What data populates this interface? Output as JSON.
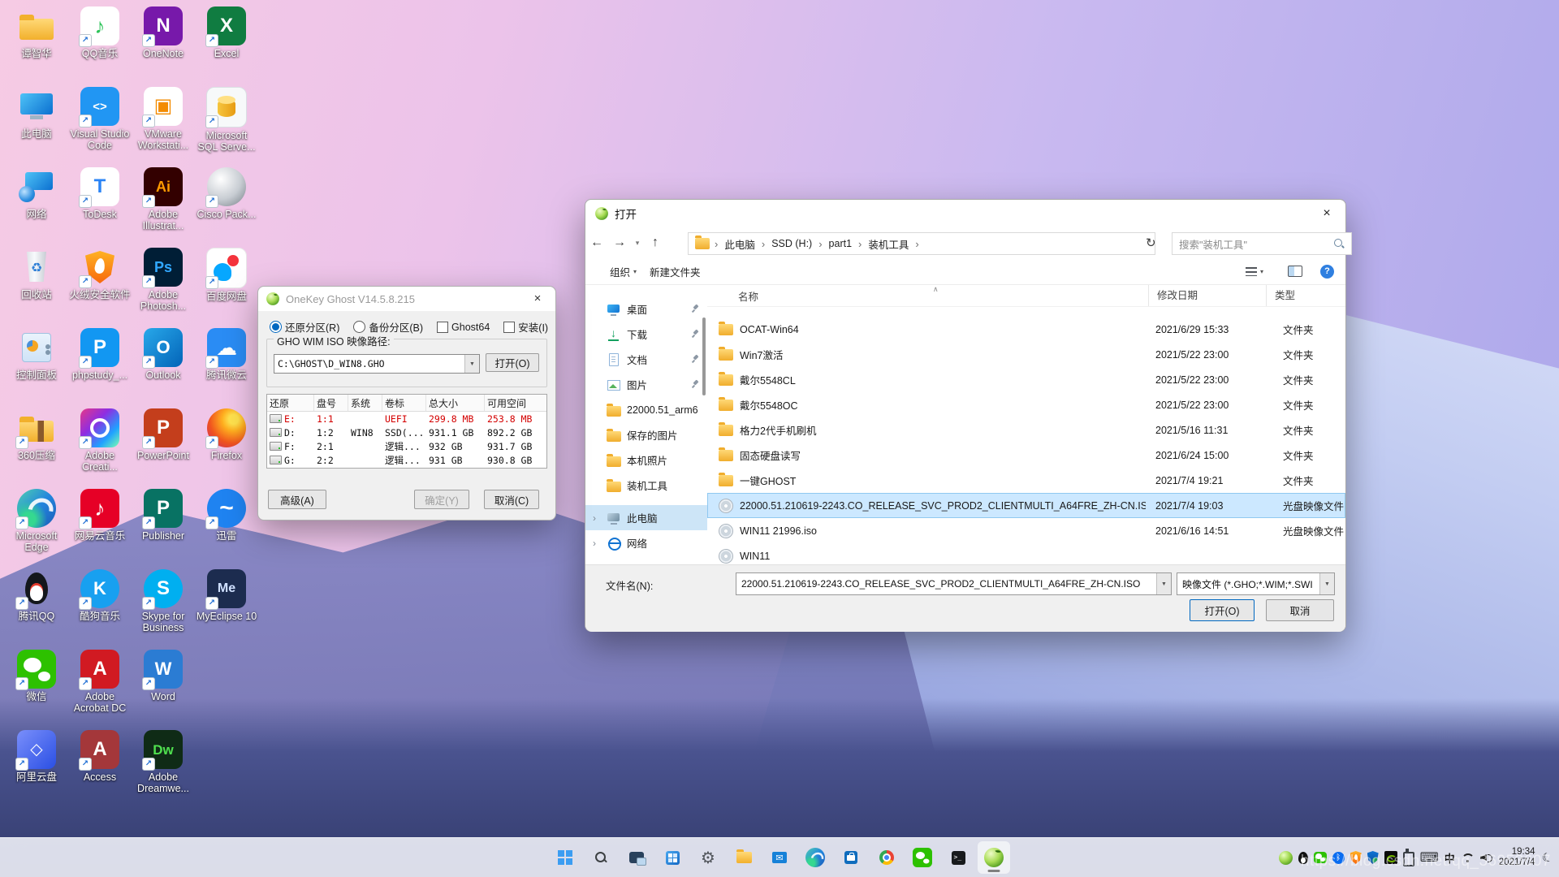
{
  "desktop": {
    "icons": [
      {
        "id": "user-folder",
        "label": "谭智华",
        "kind": "folder"
      },
      {
        "id": "this-pc",
        "label": "此电脑",
        "kind": "this-pc"
      },
      {
        "id": "network",
        "label": "网络",
        "kind": "network"
      },
      {
        "id": "recycle-bin",
        "label": "回收站",
        "kind": "recycle"
      },
      {
        "id": "control-panel",
        "label": "控制面板",
        "kind": "control-panel"
      },
      {
        "id": "360zip",
        "label": "360压缩",
        "kind": "folder-belt",
        "shortcut": true
      },
      {
        "id": "edge",
        "label": "Microsoft Edge",
        "kind": "edge",
        "shortcut": true
      },
      {
        "id": "tencent-qq",
        "label": "腾讯QQ",
        "kind": "qq",
        "shortcut": true
      },
      {
        "id": "wechat",
        "label": "微信",
        "kind": "wechat",
        "shortcut": true
      },
      {
        "id": "aliyun-drive",
        "label": "阿里云盘",
        "kind": "square",
        "bg": "linear-gradient(135deg,#7a8ffb,#2a4fe4)",
        "glyph": "◇",
        "fg": "#ffffff",
        "gs": 20,
        "shortcut": true
      },
      {
        "id": "qq-music",
        "label": "QQ音乐",
        "kind": "square",
        "bg": "#ffffff",
        "glyph": "♪",
        "fg": "#2ec45a",
        "gs": 26,
        "shortcut": true
      },
      {
        "id": "vscode",
        "label": "Visual Studio Code",
        "kind": "square",
        "bg": "#2196f3",
        "glyph": "<>",
        "fg": "#ffffff",
        "gs": 15,
        "shortcut": true
      },
      {
        "id": "todesk",
        "label": "ToDesk",
        "kind": "square",
        "bg": "#ffffff",
        "glyph": "T",
        "fg": "#2b84f5",
        "gs": 24,
        "shortcut": true
      },
      {
        "id": "huorong",
        "label": "火绒安全软件",
        "kind": "huorong",
        "shortcut": true
      },
      {
        "id": "phpstudy",
        "label": "phpstudy_...",
        "kind": "square",
        "bg": "#1297f2",
        "glyph": "P",
        "fg": "#ffffff",
        "gs": 24,
        "shortcut": true
      },
      {
        "id": "adobe-cc",
        "label": "Adobe Creati...",
        "kind": "adobe-cc",
        "shortcut": true
      },
      {
        "id": "netease-music",
        "label": "网易云音乐",
        "kind": "square",
        "bg": "#e60026",
        "glyph": "♪",
        "fg": "#ffffff",
        "gs": 26,
        "shortcut": true
      },
      {
        "id": "kugou-music",
        "label": "酷狗音乐",
        "kind": "circle",
        "bg": "#18a0f0",
        "glyph": "K",
        "fg": "#ffffff",
        "gs": 22,
        "shortcut": true
      },
      {
        "id": "acrobat",
        "label": "Adobe Acrobat DC",
        "kind": "square",
        "bg": "#d11a22",
        "glyph": "A",
        "fg": "#ffffff",
        "gs": 24,
        "shortcut": true
      },
      {
        "id": "access",
        "label": "Access",
        "kind": "square",
        "bg": "#a4373a",
        "glyph": "A",
        "fg": "#ffffff",
        "gs": 24,
        "shortcut": true
      },
      {
        "id": "onenote",
        "label": "OneNote",
        "kind": "square",
        "bg": "#7719aa",
        "glyph": "N",
        "fg": "#ffffff",
        "gs": 24,
        "shortcut": true
      },
      {
        "id": "vmware",
        "label": "VMware Workstati...",
        "kind": "square",
        "bg": "#ffffff",
        "glyph": "▣",
        "fg": "#f38b00",
        "gs": 24,
        "shortcut": true
      },
      {
        "id": "illustrator",
        "label": "Adobe Illustrat...",
        "kind": "square",
        "bg": "#330000",
        "glyph": "Ai",
        "fg": "#ff9a00",
        "gs": 18,
        "shortcut": true
      },
      {
        "id": "photoshop",
        "label": "Adobe Photosh...",
        "kind": "square",
        "bg": "#001e36",
        "glyph": "Ps",
        "fg": "#31a8ff",
        "gs": 18,
        "shortcut": true
      },
      {
        "id": "outlook",
        "label": "Outlook",
        "kind": "square",
        "bg": "linear-gradient(135deg,#28a8ea,#0364b8)",
        "glyph": "O",
        "fg": "#ffffff",
        "gs": 22,
        "shortcut": true
      },
      {
        "id": "powerpoint",
        "label": "PowerPoint",
        "kind": "square",
        "bg": "#c43e1c",
        "glyph": "P",
        "fg": "#ffffff",
        "gs": 24,
        "shortcut": true
      },
      {
        "id": "publisher",
        "label": "Publisher",
        "kind": "square",
        "bg": "#087263",
        "glyph": "P",
        "fg": "#ffffff",
        "gs": 24,
        "shortcut": true
      },
      {
        "id": "skype-business",
        "label": "Skype for Business",
        "kind": "circle",
        "bg": "#00aff0",
        "glyph": "S",
        "fg": "#ffffff",
        "gs": 24,
        "shortcut": true
      },
      {
        "id": "word",
        "label": "Word",
        "kind": "square",
        "bg": "#2b7cd3",
        "glyph": "W",
        "fg": "#ffffff",
        "gs": 22,
        "shortcut": true
      },
      {
        "id": "dreamweaver",
        "label": "Adobe Dreamwe...",
        "kind": "square",
        "bg": "#0f2b16",
        "glyph": "Dw",
        "fg": "#4fe04f",
        "gs": 17,
        "shortcut": true
      },
      {
        "id": "excel",
        "label": "Excel",
        "kind": "square",
        "bg": "#107c41",
        "glyph": "X",
        "fg": "#ffffff",
        "gs": 24,
        "shortcut": true
      },
      {
        "id": "sql-server",
        "label": "Microsoft SQL Serve...",
        "kind": "sql",
        "shortcut": true
      },
      {
        "id": "cisco-packet",
        "label": "Cisco Pack...",
        "kind": "sphere",
        "shortcut": true
      },
      {
        "id": "baidu-pan",
        "label": "百度网盘",
        "kind": "baidu",
        "shortcut": true
      },
      {
        "id": "tencent-weiyun",
        "label": "腾讯微云",
        "kind": "square",
        "bg": "#2a8cf4",
        "glyph": "☁",
        "fg": "#ffffff",
        "gs": 26,
        "shortcut": true
      },
      {
        "id": "firefox",
        "label": "Firefox",
        "kind": "firefox",
        "shortcut": true
      },
      {
        "id": "xunlei",
        "label": "迅雷",
        "kind": "circle",
        "bg": "#1f83f1",
        "glyph": "~",
        "fg": "#ffffff",
        "gs": 30,
        "shortcut": true
      },
      {
        "id": "myeclipse",
        "label": "MyEclipse 10",
        "kind": "square",
        "bg": "#1c2c4f",
        "glyph": "Me",
        "fg": "#cfe0ff",
        "gs": 16,
        "shortcut": true
      }
    ]
  },
  "onekey": {
    "title": "OneKey Ghost V14.5.8.215",
    "options": {
      "restore": "还原分区(R)",
      "backup": "备份分区(B)",
      "ghost64": "Ghost64",
      "install": "安装(I)"
    },
    "path_group": "GHO WIM ISO 映像路径:",
    "path_value": "C:\\GHOST\\D_WIN8.GHO",
    "browse": "打开(O)",
    "table_headers": [
      "还原",
      "盘号",
      "系统",
      "卷标",
      "总大小",
      "可用空间"
    ],
    "drives": [
      {
        "drive": "E:",
        "no": "1:1",
        "system": "",
        "label": "UEFI",
        "total": "299.8 MB",
        "free": "253.8 MB",
        "alert": true
      },
      {
        "drive": "D:",
        "no": "1:2",
        "system": "WIN8",
        "label": "SSD(...",
        "total": "931.1 GB",
        "free": "892.2 GB"
      },
      {
        "drive": "F:",
        "no": "2:1",
        "system": "",
        "label": "逻辑...",
        "total": "932 GB",
        "free": "931.7 GB"
      },
      {
        "drive": "G:",
        "no": "2:2",
        "system": "",
        "label": "逻辑...",
        "total": "931 GB",
        "free": "930.8 GB"
      }
    ],
    "advanced": "高级(A)",
    "ok": "确定(Y)",
    "cancel": "取消(C)",
    "alert_color": "#d40000"
  },
  "open": {
    "title": "打开",
    "breadcrumb": [
      "此电脑",
      "SSD (H:)",
      "part1",
      "装机工具"
    ],
    "search": "搜索\"装机工具\"",
    "organize": "组织",
    "new_folder": "新建文件夹",
    "sidebar": [
      {
        "id": "desktop",
        "label": "桌面",
        "icon": "desktop",
        "pinned": true
      },
      {
        "id": "downloads",
        "label": "下载",
        "icon": "downloads",
        "pinned": true
      },
      {
        "id": "documents",
        "label": "文档",
        "icon": "documents",
        "pinned": true
      },
      {
        "id": "pictures",
        "label": "图片",
        "icon": "pictures",
        "pinned": true
      },
      {
        "id": "folder-22000",
        "label": "22000.51_arm6",
        "icon": "folder"
      },
      {
        "id": "saved-pictures",
        "label": "保存的图片",
        "icon": "folder"
      },
      {
        "id": "local-photos",
        "label": "本机照片",
        "icon": "folder"
      },
      {
        "id": "install-tools",
        "label": "装机工具",
        "icon": "folder"
      },
      {
        "id": "this-pc",
        "label": "此电脑",
        "icon": "computer",
        "expand": true,
        "selected": true,
        "gap": true
      },
      {
        "id": "network",
        "label": "网络",
        "icon": "network",
        "expand": true
      }
    ],
    "columns": [
      "名称",
      "修改日期",
      "类型"
    ],
    "files": [
      {
        "name": "OCAT-Win64",
        "date": "2021/6/29 15:33",
        "type": "文件夹",
        "icon": "folder"
      },
      {
        "name": "Win7激活",
        "date": "2021/5/22 23:00",
        "type": "文件夹",
        "icon": "folder"
      },
      {
        "name": "戴尔5548CL",
        "date": "2021/5/22 23:00",
        "type": "文件夹",
        "icon": "folder"
      },
      {
        "name": "戴尔5548OC",
        "date": "2021/5/22 23:00",
        "type": "文件夹",
        "icon": "folder"
      },
      {
        "name": "格力2代手机刷机",
        "date": "2021/5/16 11:31",
        "type": "文件夹",
        "icon": "folder"
      },
      {
        "name": "固态硬盘读写",
        "date": "2021/6/24 15:00",
        "type": "文件夹",
        "icon": "folder"
      },
      {
        "name": "一键GHOST",
        "date": "2021/7/4 19:21",
        "type": "文件夹",
        "icon": "folder"
      },
      {
        "name": "22000.51.210619-2243.CO_RELEASE_SVC_PROD2_CLIENTMULTI_A64FRE_ZH-CN.ISO",
        "date": "2021/7/4 19:03",
        "type": "光盘映像文件",
        "icon": "disc",
        "selected": true
      },
      {
        "name": "WIN11 21996.iso",
        "date": "2021/6/16 14:51",
        "type": "光盘映像文件",
        "icon": "disc"
      },
      {
        "name": "WIN11",
        "date": "",
        "type": "",
        "icon": "disc",
        "clipped": true
      }
    ],
    "filename_label": "文件名(N):",
    "filename": "22000.51.210619-2243.CO_RELEASE_SVC_PROD2_CLIENTMULTI_A64FRE_ZH-CN.ISO",
    "filetype": "映像文件 (*.GHO;*.WIM;*.SWI",
    "open_btn": "打开(O)",
    "cancel_btn": "取消"
  },
  "taskbar": {
    "pinned": [
      {
        "id": "start",
        "kind": "start"
      },
      {
        "id": "search",
        "kind": "search"
      },
      {
        "id": "task-view",
        "kind": "taskview"
      },
      {
        "id": "widgets",
        "kind": "widgets"
      },
      {
        "id": "settings",
        "kind": "settings"
      },
      {
        "id": "file-explorer",
        "kind": "explorer"
      },
      {
        "id": "mail",
        "kind": "mail"
      },
      {
        "id": "edge",
        "kind": "edge-mini"
      },
      {
        "id": "store",
        "kind": "store"
      },
      {
        "id": "chrome",
        "kind": "chrome"
      },
      {
        "id": "wechat",
        "kind": "wechat-mini"
      },
      {
        "id": "terminal",
        "kind": "terminal"
      },
      {
        "id": "onekey-ghost",
        "kind": "onekey",
        "active": true
      }
    ],
    "tray": [
      {
        "id": "onekey-ghost",
        "kind": "onekey"
      },
      {
        "id": "qq",
        "kind": "qq-mini"
      },
      {
        "id": "wechat",
        "kind": "wechat-mini"
      },
      {
        "id": "bluetooth",
        "kind": "bt"
      },
      {
        "id": "huorong",
        "kind": "shield-orange"
      },
      {
        "id": "defender",
        "kind": "defender"
      },
      {
        "id": "nvidia",
        "kind": "nvidia"
      },
      {
        "id": "usb",
        "kind": "usb"
      },
      {
        "id": "keyboard",
        "kind": "kbd"
      },
      {
        "id": "ime",
        "text": "中"
      },
      {
        "id": "wifi",
        "kind": "wifi"
      },
      {
        "id": "volume",
        "kind": "vol"
      }
    ],
    "ime": "中",
    "clock": {
      "time": "19:34",
      "date": "2021/7/4"
    }
  },
  "watermark": "https://blog.csdn.net/qq_36953607"
}
